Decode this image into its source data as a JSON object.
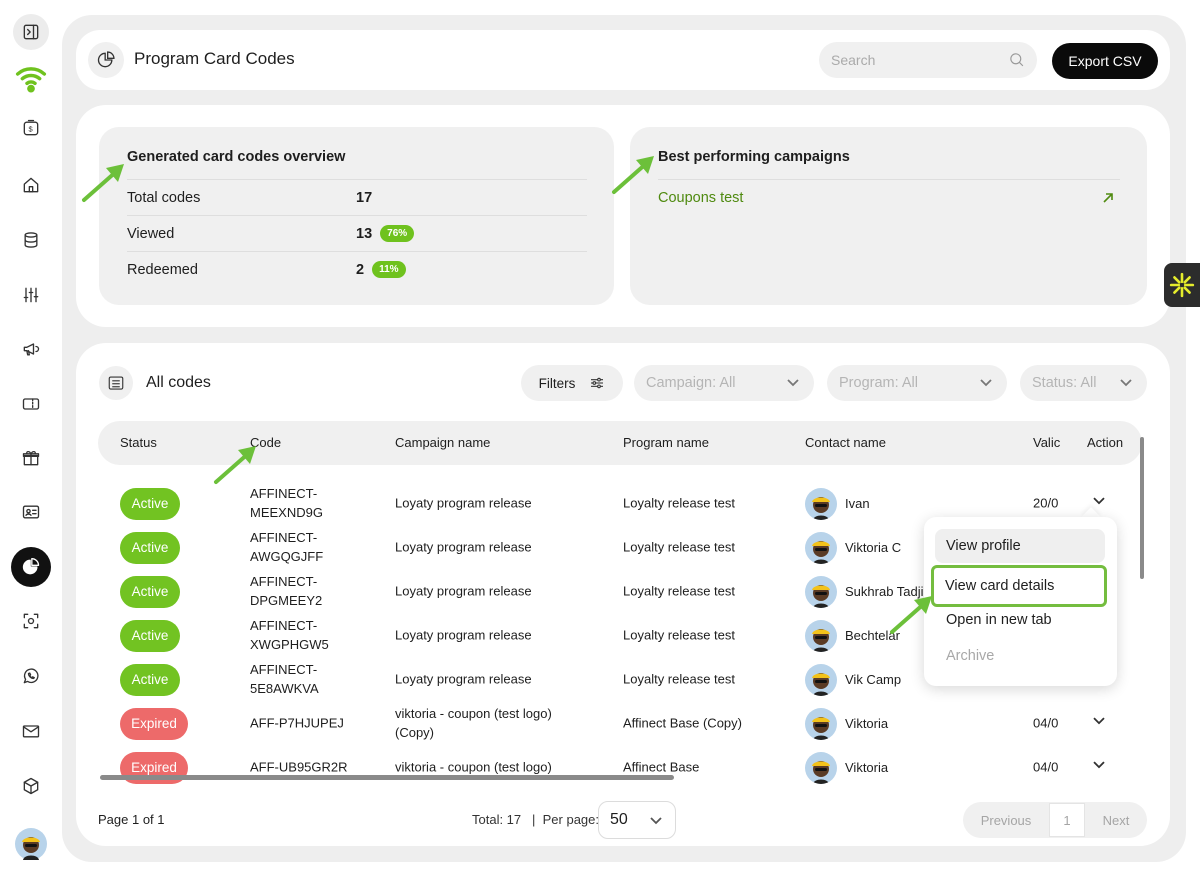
{
  "header": {
    "title": "Program Card Codes",
    "search_placeholder": "Search",
    "export_label": "Export CSV"
  },
  "overview": {
    "title": "Generated card codes overview",
    "rows": [
      {
        "label": "Total codes",
        "value": "17",
        "badge": ""
      },
      {
        "label": "Viewed",
        "value": "13",
        "badge": "76%"
      },
      {
        "label": "Redeemed",
        "value": "2",
        "badge": "11%"
      }
    ]
  },
  "best": {
    "title": "Best performing campaigns",
    "campaign": "Coupons test"
  },
  "codes": {
    "title": "All codes",
    "filters_label": "Filters",
    "campaign_dd": "Campaign: All",
    "program_dd": "Program: All",
    "status_dd": "Status: All",
    "columns": {
      "status": "Status",
      "code": "Code",
      "campaign": "Campaign name",
      "program": "Program name",
      "contact": "Contact name",
      "valid": "Valic",
      "action": "Action"
    },
    "rows": [
      {
        "status": "Active",
        "code": "AFFINECT-MEEXND9G",
        "campaign": "Loyaty program release",
        "program": "Loyalty release test",
        "contact": "Ivan",
        "valid": "20/0"
      },
      {
        "status": "Active",
        "code": "AFFINECT-AWGQGJFF",
        "campaign": "Loyaty program release",
        "program": "Loyalty release test",
        "contact": "Viktoria C",
        "valid": ""
      },
      {
        "status": "Active",
        "code": "AFFINECT-DPGMEEY2",
        "campaign": "Loyaty program release",
        "program": "Loyalty release test",
        "contact": "Sukhrab Tadji",
        "valid": ""
      },
      {
        "status": "Active",
        "code": "AFFINECT-XWGPHGW5",
        "campaign": "Loyaty program release",
        "program": "Loyalty release test",
        "contact": "Bechtelar",
        "valid": ""
      },
      {
        "status": "Active",
        "code": "AFFINECT-5E8AWKVA",
        "campaign": "Loyaty program release",
        "program": "Loyalty release test",
        "contact": "Vik Camp",
        "valid": ""
      },
      {
        "status": "Expired",
        "code": "AFF-P7HJUPEJ",
        "campaign": "viktoria - coupon (test logo) (Copy)",
        "program": "Affinect Base (Copy)",
        "contact": "Viktoria",
        "valid": "04/0"
      },
      {
        "status": "Expired",
        "code": "AFF-UB95GR2R",
        "campaign": "viktoria - coupon (test logo)",
        "program": "Affinect Base",
        "contact": "Viktoria",
        "valid": "04/0"
      }
    ]
  },
  "footer": {
    "page": "Page 1 of 1",
    "total": "Total: 17",
    "sep": "|",
    "per_page_label": "Per page:",
    "per_page_value": "50",
    "prev": "Previous",
    "current": "1",
    "next": "Next"
  },
  "action_menu": {
    "items": [
      "View profile",
      "View card details",
      "Open in new tab",
      "Archive"
    ]
  },
  "colors": {
    "accent_green": "#72c322",
    "expired_red": "#ed6a6a",
    "highlight": "#74bd3f"
  }
}
